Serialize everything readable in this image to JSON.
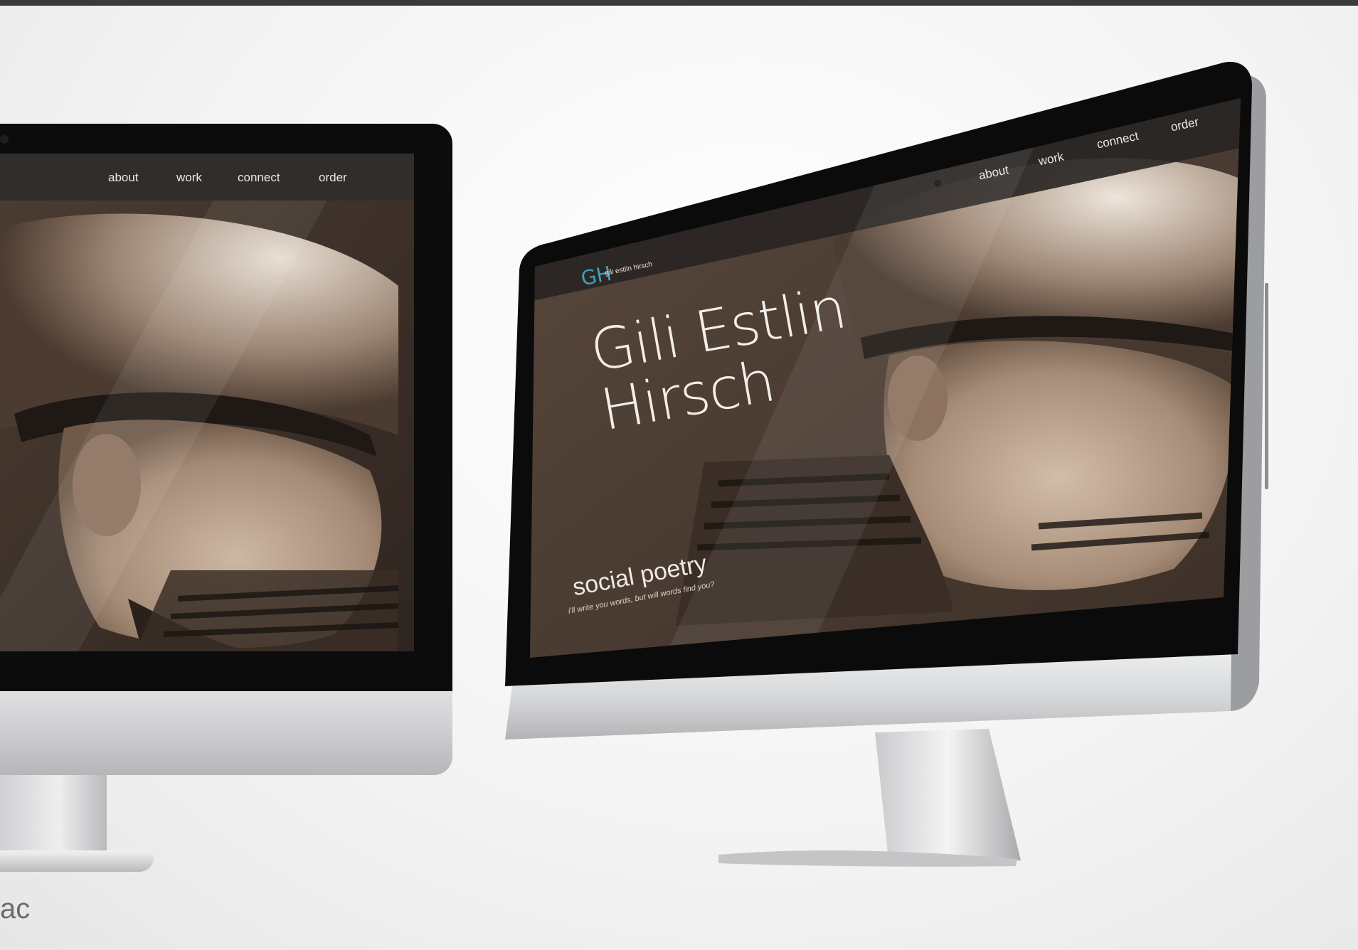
{
  "left_monitor": {
    "nav": [
      "about",
      "work",
      "connect",
      "order"
    ],
    "caption": "ac"
  },
  "right_monitor": {
    "logo": {
      "mark": "GH",
      "text": "gili estlin hirsch"
    },
    "nav": [
      "about",
      "work",
      "connect",
      "order"
    ],
    "hero": {
      "title_line1": "Gili Estlin",
      "title_line2": "Hirsch",
      "subtitle": "social poetry",
      "tagline": "i'll write you words, but will words find you?"
    }
  },
  "colors": {
    "accent": "#3fa3b5",
    "photo_tone": "#5a4a3e",
    "bezel": "#0c0c0c",
    "aluminum": "#d6d7d9"
  }
}
